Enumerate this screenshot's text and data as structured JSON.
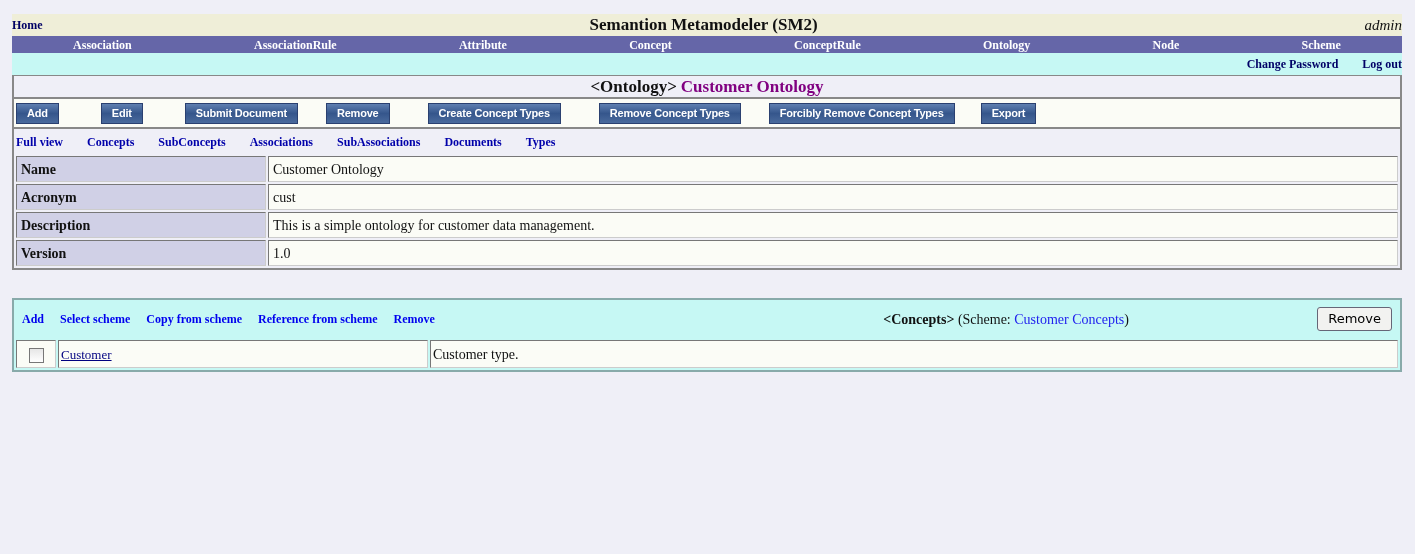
{
  "header": {
    "home_link": "Home",
    "title": "Semantion Metamodeler (SM2)",
    "user": "admin"
  },
  "nav": [
    "Association",
    "AssociationRule",
    "Attribute",
    "Concept",
    "ConceptRule",
    "Ontology",
    "Node",
    "Scheme"
  ],
  "account_links": [
    "Change Password",
    "Log out"
  ],
  "entity": {
    "type_label": "<Ontology>",
    "name": "Customer Ontology"
  },
  "actions": [
    "Add",
    "Edit",
    "Submit Document",
    "Remove",
    "Create Concept Types",
    "Remove Concept Types",
    "Forcibly Remove Concept Types",
    "Export"
  ],
  "views": [
    "Full view",
    "Concepts",
    "SubConcepts",
    "Associations",
    "SubAssociations",
    "Documents",
    "Types"
  ],
  "properties": [
    {
      "label": "Name",
      "value": "Customer Ontology"
    },
    {
      "label": "Acronym",
      "value": "cust"
    },
    {
      "label": "Description",
      "value": "This is a simple ontology for customer data management."
    },
    {
      "label": "Version",
      "value": "1.0"
    }
  ],
  "concepts": {
    "links": [
      "Add",
      "Select scheme",
      "Copy from scheme",
      "Reference from scheme",
      "Remove"
    ],
    "heading": "**<Concepts>** (Scheme: ",
    "scheme_link": "Customer Concepts",
    "heading_end": ")",
    "remove_button": "Remove",
    "rows": [
      {
        "checked": false,
        "name": "Customer",
        "description": "Customer type."
      }
    ]
  }
}
